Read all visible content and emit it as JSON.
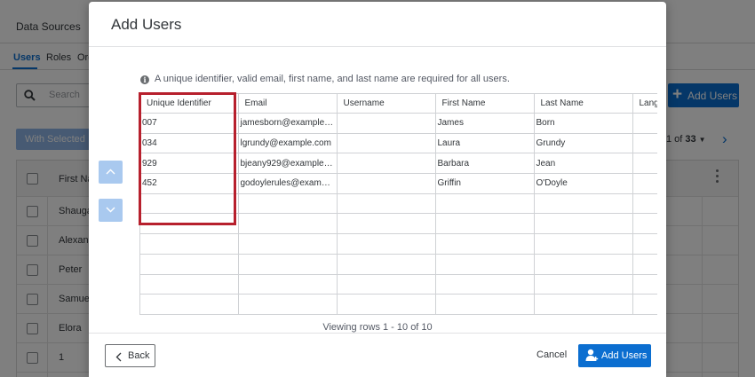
{
  "background": {
    "title": "Data Sources",
    "tabs": [
      "Users",
      "Roles",
      "Org"
    ],
    "search_placeholder": "Search",
    "with_selected_label": "With Selected",
    "add_users_label": "Add Users",
    "pager": {
      "text_prefix": "1 of ",
      "total": "33"
    },
    "table": {
      "header": "First Nam",
      "rows": [
        "Shaugat",
        "Alexande",
        "Peter",
        "Samuel",
        "Elora",
        "1"
      ]
    }
  },
  "modal": {
    "title": "Add Users",
    "info_text": "A unique identifier, valid email, first name, and last name are required for all users.",
    "columns": [
      "Unique Identifier",
      "Email",
      "Username",
      "First Name",
      "Last Name",
      "Lang"
    ],
    "rows": [
      [
        "007",
        "jamesborn@example.c…",
        "",
        "James",
        "Born",
        ""
      ],
      [
        "034",
        "lgrundy@example.com",
        "",
        "Laura",
        "Grundy",
        ""
      ],
      [
        "929",
        "bjeany929@example.com",
        "",
        "Barbara",
        "Jean",
        ""
      ],
      [
        "452",
        "godoylerules@example…",
        "",
        "Griffin",
        "O'Doyle",
        ""
      ],
      [
        "",
        "",
        "",
        "",
        "",
        ""
      ],
      [
        "",
        "",
        "",
        "",
        "",
        ""
      ],
      [
        "",
        "",
        "",
        "",
        "",
        ""
      ],
      [
        "",
        "",
        "",
        "",
        "",
        ""
      ],
      [
        "",
        "",
        "",
        "",
        "",
        ""
      ],
      [
        "",
        "",
        "",
        "",
        "",
        ""
      ]
    ],
    "viewing_text": "Viewing rows 1 - 10 of 10",
    "back_label": "Back",
    "cancel_label": "Cancel",
    "add_users_label": "Add Users"
  },
  "colors": {
    "accent": "#0b6ed0",
    "highlight": "#b7202d",
    "arrow_button": "#a9c9ef"
  }
}
